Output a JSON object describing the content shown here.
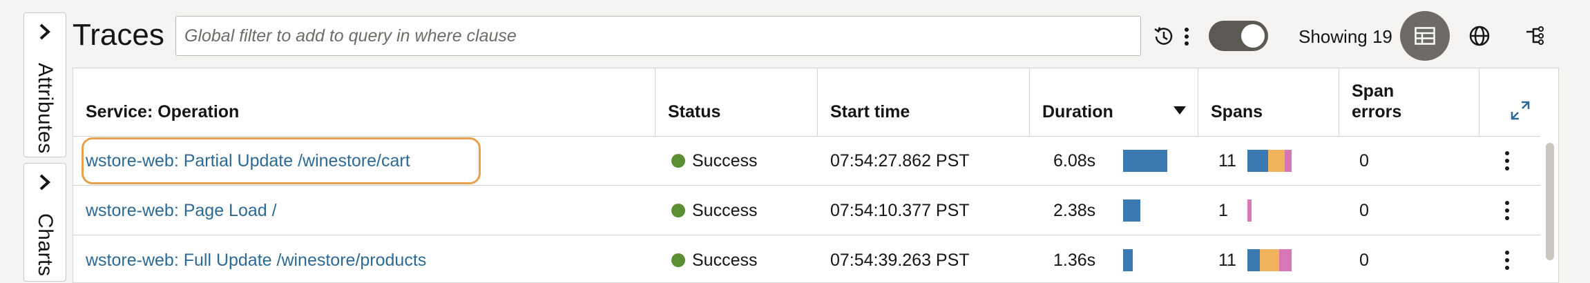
{
  "sidebar": {
    "tabs": [
      {
        "label": "Attributes"
      },
      {
        "label": "Charts"
      }
    ]
  },
  "header": {
    "title": "Traces",
    "filter_placeholder": "Global filter to add to query in where clause",
    "showing_text": "Showing 19",
    "toggle_on": true
  },
  "table": {
    "columns": {
      "service_operation": "Service: Operation",
      "status": "Status",
      "start_time": "Start time",
      "duration": "Duration",
      "spans": "Spans",
      "span_errors_line1": "Span",
      "span_errors_line2": "errors"
    },
    "sort_column": "duration",
    "sort_direction": "descending",
    "rows": [
      {
        "operation": "wstore-web: Partial Update /winestore/cart",
        "status": "Success",
        "start_time": "07:54:27.862 PST",
        "duration": "6.08s",
        "duration_fraction": 1.0,
        "spans": "11",
        "span_errors": "0",
        "highlighted": true
      },
      {
        "operation": "wstore-web: Page Load /",
        "status": "Success",
        "start_time": "07:54:10.377 PST",
        "duration": "2.38s",
        "duration_fraction": 0.39,
        "spans": "1",
        "span_errors": "0",
        "highlighted": false
      },
      {
        "operation": "wstore-web: Full Update /winestore/products",
        "status": "Success",
        "start_time": "07:54:39.263 PST",
        "duration": "1.36s",
        "duration_fraction": 0.22,
        "spans": "11",
        "span_errors": "0",
        "highlighted": false
      }
    ]
  },
  "colors": {
    "link": "#2c6a96",
    "success": "#5c8f35",
    "duration_bar": "#3b79b2",
    "span_blue": "#3b79b2",
    "span_orange": "#f2b35f",
    "span_pink": "#d877b3",
    "highlight": "#e8a04a"
  }
}
